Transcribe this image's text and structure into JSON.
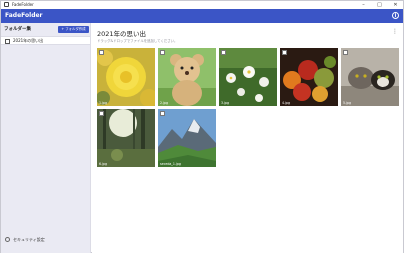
{
  "window": {
    "title": "FadeFolder",
    "controls": [
      "–",
      "□",
      "✕"
    ]
  },
  "header": {
    "brand": "FadeFolder",
    "info_icon": "info-icon"
  },
  "sidebar": {
    "title": "フォルダー集",
    "add_button": "+ フォルダ作成",
    "folders": [
      {
        "label": "2021年の思い出",
        "icon": "folder-icon"
      }
    ],
    "security_label": "セキュリティ設定"
  },
  "main": {
    "title": "2021年の思い出",
    "subtitle": "ドラッグ&ドロップでファイルを追加してください。",
    "more_icon": "⋮",
    "images": [
      {
        "name": "1.jpg",
        "subject": "yellow roses"
      },
      {
        "name": "2.jpg",
        "subject": "teddy bear"
      },
      {
        "name": "3.jpg",
        "subject": "white flowers"
      },
      {
        "name": "4.jpg",
        "subject": "fruits"
      },
      {
        "name": "5.jpg",
        "subject": "cats"
      },
      {
        "name": "6.jpg",
        "subject": "forest"
      },
      {
        "name": "seceda_1.jpg",
        "subject": "mountains"
      }
    ]
  },
  "colors": {
    "accent": "#3b55c6",
    "sidebar_bg": "#eaeaf3"
  }
}
